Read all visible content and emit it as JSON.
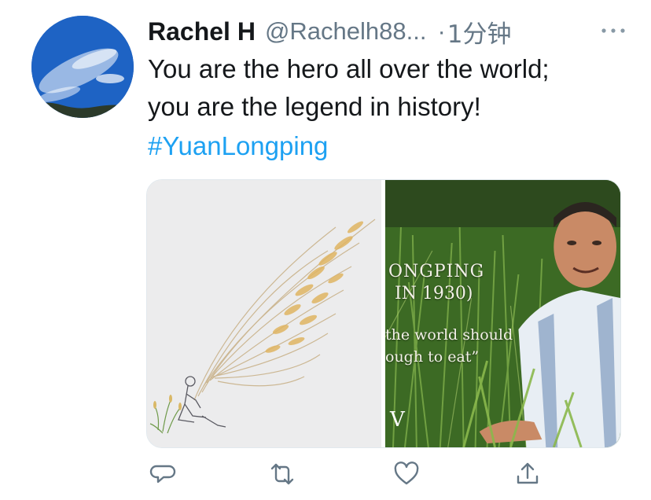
{
  "tweet": {
    "author_name": "Rachel H",
    "author_handle": "@Rachelh88...",
    "separator": "·",
    "timestamp": "1分钟",
    "text_line_1": "You are the hero all over the world;",
    "text_line_2": "you are the legend in history!",
    "hashtag": "#YuanLongping"
  },
  "media": {
    "right_image_text": {
      "line_1": "ONGPING",
      "line_2": "IN 1930)",
      "line_3": "the world should",
      "line_4": "ough to eat”",
      "logo_mark": "V"
    }
  },
  "icons": {
    "more": "more-icon",
    "reply": "reply-icon",
    "retweet": "retweet-icon",
    "like": "like-icon",
    "share": "share-icon"
  },
  "colors": {
    "link": "#1da1f2",
    "secondary_text": "#657786",
    "primary_text": "#14171a"
  }
}
